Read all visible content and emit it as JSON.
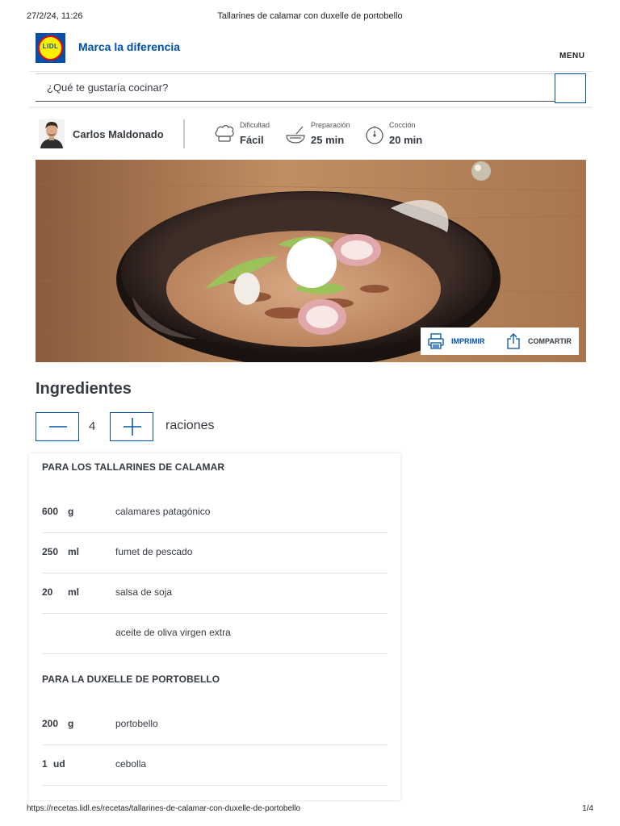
{
  "print": {
    "datetime": "27/2/24, 11:26",
    "document_title": "Tallarines de calamar con duxelle de portobello",
    "url": "https://recetas.lidl.es/recetas/tallarines-de-calamar-con-duxelle-de-portobello",
    "page": "1/4"
  },
  "header": {
    "logo_text": "LIDL",
    "tagline": "Marca la diferencia",
    "menu_label": "MENU"
  },
  "search": {
    "placeholder": "¿Qué te gustaría cocinar?"
  },
  "recipe_meta": {
    "author": "Carlos Maldonado",
    "items": [
      {
        "label": "Dificultad",
        "value": "Fácil",
        "icon": "chef-hat-icon"
      },
      {
        "label": "Preparación",
        "value": "25 min",
        "icon": "mixing-bowl-icon"
      },
      {
        "label": "Cocción",
        "value": "20 min",
        "icon": "timer-icon"
      }
    ]
  },
  "hero_actions": {
    "print_label": "IMPRIMIR",
    "share_label": "COMPARTIR"
  },
  "ingredients": {
    "title": "Ingredientes",
    "servings": "4",
    "servings_label": "raciones",
    "groups": [
      {
        "title": "PARA LOS TALLARINES DE CALAMAR",
        "items": [
          {
            "qty": "600",
            "unit": "g",
            "name": "calamares patagónico"
          },
          {
            "qty": "250",
            "unit": "ml",
            "name": "fumet de pescado"
          },
          {
            "qty": "20",
            "unit": "ml",
            "name": "salsa de soja"
          },
          {
            "qty": "",
            "unit": "",
            "name": "aceite de oliva virgen extra"
          }
        ]
      },
      {
        "title": "PARA LA DUXELLE DE PORTOBELLO",
        "items": [
          {
            "qty": "200",
            "unit": "g",
            "name": "portobello"
          },
          {
            "qty": "1",
            "unit": "ud",
            "name": "cebolla"
          }
        ]
      }
    ]
  },
  "colors": {
    "brand_blue": "#0050aa",
    "brand_yellow": "#fff000",
    "brand_red": "#e60a14",
    "text": "#353b42"
  }
}
